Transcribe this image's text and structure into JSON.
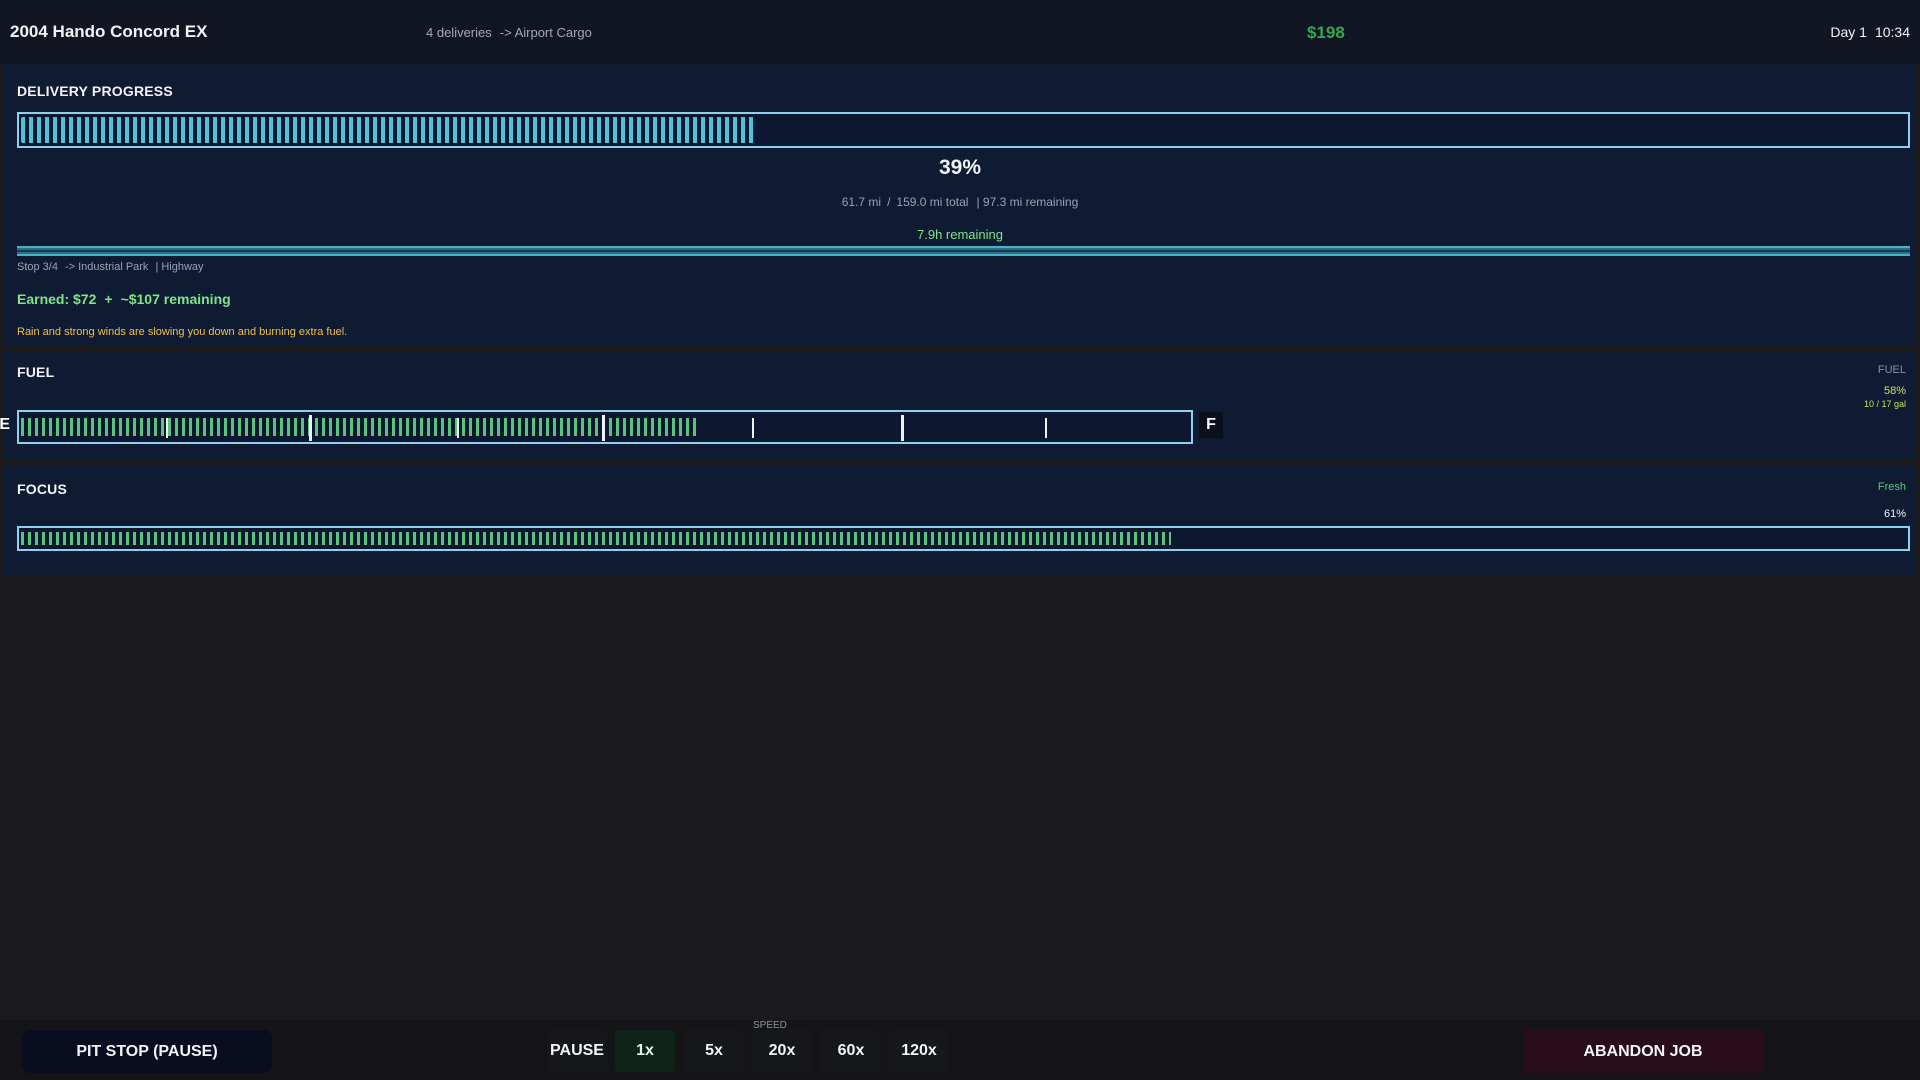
{
  "header": {
    "vehicle": "2004 Hando Concord EX",
    "deliveries": "4 deliveries",
    "destination": "-> Airport Cargo",
    "cash": "$198",
    "day": "Day 1",
    "time": "10:34"
  },
  "delivery": {
    "title": "DELIVERY PROGRESS",
    "progress_fraction": 0.39,
    "percent_label": "39%",
    "miles_driven": "61.7 mi",
    "miles_sep": "/",
    "miles_total": "159.0 mi total",
    "miles_remaining": "| 97.3 mi remaining",
    "time_remaining": "7.9h remaining",
    "stop": "Stop 3/4",
    "stop_destination": "-> Industrial Park",
    "road": "| Highway",
    "earned": "Earned: $72",
    "earned_plus": "+",
    "earned_remaining": "~$107 remaining",
    "warning": "Rain and strong winds are slowing you down and burning extra fuel.",
    "accent_color": "#4ec3d7"
  },
  "fuel": {
    "title": "FUEL",
    "side_label": "FUEL",
    "percent_label": "58%",
    "fraction": 0.58,
    "gallons": "10 / 17 gal",
    "empty_label": "E",
    "full_label": "F",
    "color": "#5bc47c"
  },
  "focus": {
    "title": "FOCUS",
    "state": "Fresh",
    "percent_label": "61%",
    "fraction": 0.61,
    "color": "#5bc47c"
  },
  "controls": {
    "pit_stop": "PIT STOP (PAUSE)",
    "speed_label": "SPEED",
    "pause": "PAUSE",
    "speeds": [
      "1x",
      "5x",
      "20x",
      "60x",
      "120x"
    ],
    "active_speed": "1x",
    "abandon": "ABANDON JOB"
  }
}
